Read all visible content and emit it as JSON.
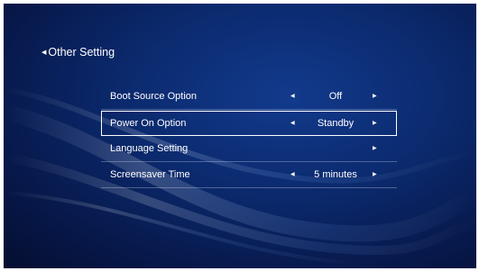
{
  "header": {
    "back_label": "Other Setting",
    "back_icon": "triangle-left-icon"
  },
  "settings": [
    {
      "label": "Boot Source Option",
      "value": "Off",
      "has_left_arrow": true,
      "has_right_arrow": true,
      "selected": false
    },
    {
      "label": "Power On Option",
      "value": "Standby",
      "has_left_arrow": true,
      "has_right_arrow": true,
      "selected": true
    },
    {
      "label": "Language Setting",
      "value": "",
      "has_left_arrow": false,
      "has_right_arrow": true,
      "selected": false
    },
    {
      "label": "Screensaver Time",
      "value": "5 minutes",
      "has_left_arrow": true,
      "has_right_arrow": true,
      "selected": false
    }
  ],
  "colors": {
    "background": "#0b2a6e",
    "text": "#ffffff",
    "selection_border": "#ffffff"
  }
}
